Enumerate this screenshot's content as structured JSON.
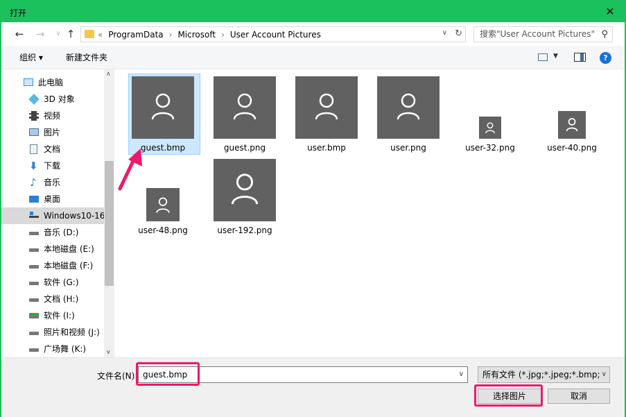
{
  "window": {
    "title": "打开",
    "close": "✕"
  },
  "nav": {
    "back": "←",
    "forward": "→",
    "up": "↑"
  },
  "address": {
    "crumb_prefix": "«",
    "crumbs": [
      "ProgramData",
      "Microsoft",
      "User Account Pictures"
    ],
    "separator": "›"
  },
  "search": {
    "placeholder": "搜索\"User Account Pictures\""
  },
  "toolbar": {
    "organize": "组织 ▾",
    "new_folder": "新建文件夹",
    "help": "?"
  },
  "sidebar": {
    "items": [
      {
        "label": "此电脑",
        "icon": "pc-icon"
      },
      {
        "label": "3D 对象",
        "icon": "3d-objects-icon"
      },
      {
        "label": "视频",
        "icon": "video-icon"
      },
      {
        "label": "图片",
        "icon": "pictures-icon"
      },
      {
        "label": "文档",
        "icon": "documents-icon"
      },
      {
        "label": "下载",
        "icon": "download-icon"
      },
      {
        "label": "音乐",
        "icon": "music-icon"
      },
      {
        "label": "桌面",
        "icon": "desktop-icon"
      },
      {
        "label": "Windows10-16",
        "icon": "drive-icon"
      },
      {
        "label": "音乐 (D:)",
        "icon": "drive-icon"
      },
      {
        "label": "本地磁盘 (E:)",
        "icon": "drive-icon"
      },
      {
        "label": "本地磁盘 (F:)",
        "icon": "drive-icon"
      },
      {
        "label": "软件 (G:)",
        "icon": "drive-icon"
      },
      {
        "label": "文档 (H:)",
        "icon": "drive-icon"
      },
      {
        "label": "软件  (I:)",
        "icon": "drive-icon"
      },
      {
        "label": "照片和视频 (J:)",
        "icon": "drive-icon"
      },
      {
        "label": "广场舞 (K:)",
        "icon": "drive-icon"
      }
    ]
  },
  "files": [
    {
      "name": "guest.bmp"
    },
    {
      "name": "guest.png"
    },
    {
      "name": "user.bmp"
    },
    {
      "name": "user.png"
    },
    {
      "name": "user-32.png"
    },
    {
      "name": "user-40.png"
    },
    {
      "name": "user-48.png"
    },
    {
      "name": "user-192.png"
    }
  ],
  "footer": {
    "filename_label": "文件名(N):",
    "filename_value": "guest.bmp",
    "filetype": "所有文件 (*.jpg;*.jpeg;*.bmp;*.",
    "ok_label": "选择图片",
    "cancel_label": "取消"
  },
  "colors": {
    "titlebar": "#1bc15c",
    "highlight": "#f0186a",
    "thumbnail": "#616161",
    "selection": "#cce8ff"
  }
}
